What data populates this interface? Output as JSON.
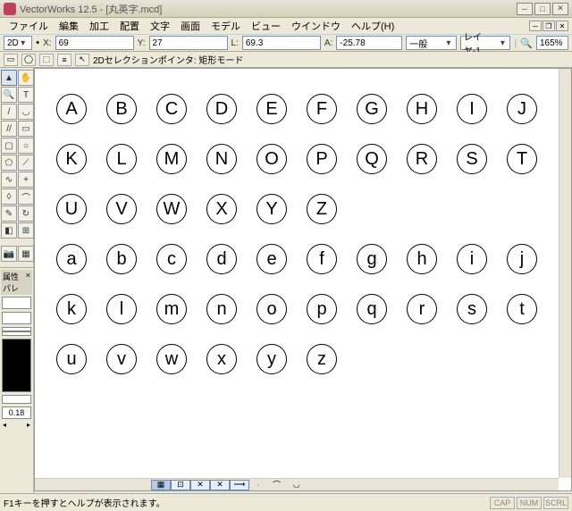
{
  "title": "VectorWorks 12.5 - [丸英字.mcd]",
  "menu": [
    "ファイル",
    "編集",
    "加工",
    "配置",
    "文字",
    "画面",
    "モデル",
    "ビュー",
    "ウインドウ",
    "ヘルプ(H)"
  ],
  "toolbar1": {
    "mode": "2D",
    "x_label": "X:",
    "x_value": "69",
    "y_label": "Y:",
    "y_value": "27",
    "l_label": "L:",
    "l_value": "69.3",
    "a_label": "A:",
    "a_value": "-25.78",
    "class_label": "一般",
    "layer_label": "レイヤ-1",
    "zoom": "165%"
  },
  "toolbar2": {
    "mode_text": "2Dセレクションポインタ: 矩形モード"
  },
  "attr": {
    "header": "属性パレ",
    "num": "0.18"
  },
  "status": {
    "help": "F1キーを押すとヘルプが表示されます。",
    "caps": "CAP",
    "num": "NUM",
    "scrl": "SCRL"
  },
  "letters": {
    "upper": [
      "A",
      "B",
      "C",
      "D",
      "E",
      "F",
      "G",
      "H",
      "I",
      "J",
      "K",
      "L",
      "M",
      "N",
      "O",
      "P",
      "Q",
      "R",
      "S",
      "T",
      "U",
      "V",
      "W",
      "X",
      "Y",
      "Z"
    ],
    "lower": [
      "a",
      "b",
      "c",
      "d",
      "e",
      "f",
      "g",
      "h",
      "i",
      "j",
      "k",
      "l",
      "m",
      "n",
      "o",
      "p",
      "q",
      "r",
      "s",
      "t",
      "u",
      "v",
      "w",
      "x",
      "y",
      "z"
    ]
  }
}
